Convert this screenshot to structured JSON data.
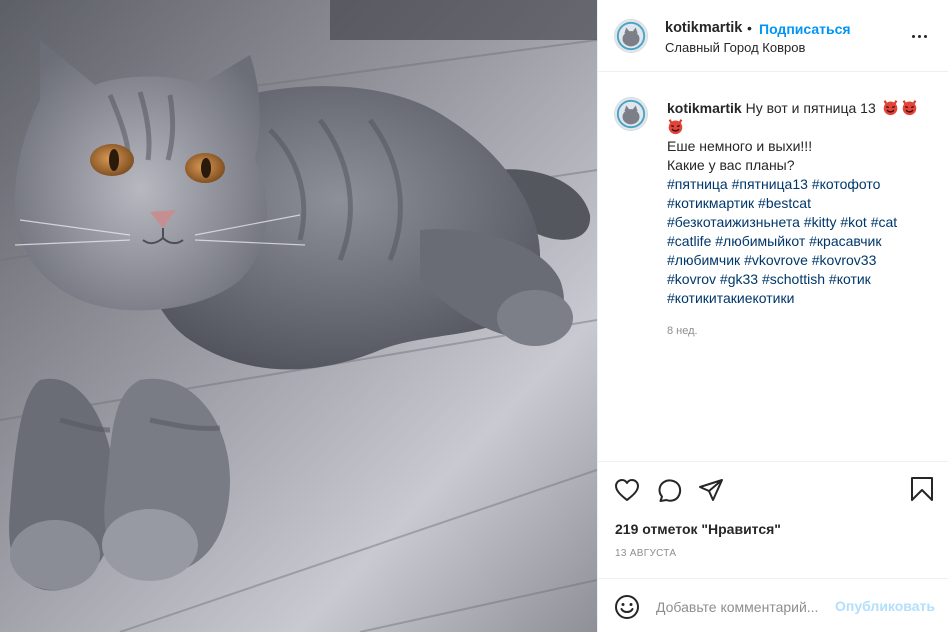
{
  "post": {
    "image_alt": "cat-photo",
    "username": "kotikmartik",
    "separator": "•",
    "follow_label": "Подписаться",
    "location": "Славный Город Ковров"
  },
  "caption": {
    "username": "kotikmartik",
    "first_line": "Ну вот и пятница 13",
    "lines": [
      "Еше немного и выхи!!!",
      "Какие у вас планы?"
    ],
    "hashtag_lines": [
      [
        "#пятница",
        "#пятница13",
        "#котофото"
      ],
      [
        "#котикмартик",
        "#bestcat"
      ],
      [
        "#безкотаижизньнета",
        "#kitty",
        "#kot",
        "#cat"
      ],
      [
        "#catlife",
        "#любимыйкот",
        "#красавчик"
      ],
      [
        "#любимчик",
        "#vkovrove",
        "#kovrov33"
      ],
      [
        "#kovrov",
        "#gk33",
        "#schottish",
        "#котик"
      ],
      [
        "#котикитакиекотики"
      ]
    ],
    "time_ago": "8 нед."
  },
  "stats": {
    "likes": "219 отметок \"Нравится\"",
    "date": "13 АВГУСТА"
  },
  "comment": {
    "placeholder": "Добавьте комментарий...",
    "publish_label": "Опубликовать"
  },
  "icons": {
    "like": "heart-icon",
    "comment": "comment-icon",
    "share": "send-icon",
    "save": "bookmark-icon",
    "more": "more-options-icon",
    "emoji": "smiley-icon"
  },
  "colors": {
    "link_blue": "#0095f6",
    "hashtag": "#00376b",
    "muted": "#8e8e8e",
    "publish_disabled": "#b2dffc"
  }
}
